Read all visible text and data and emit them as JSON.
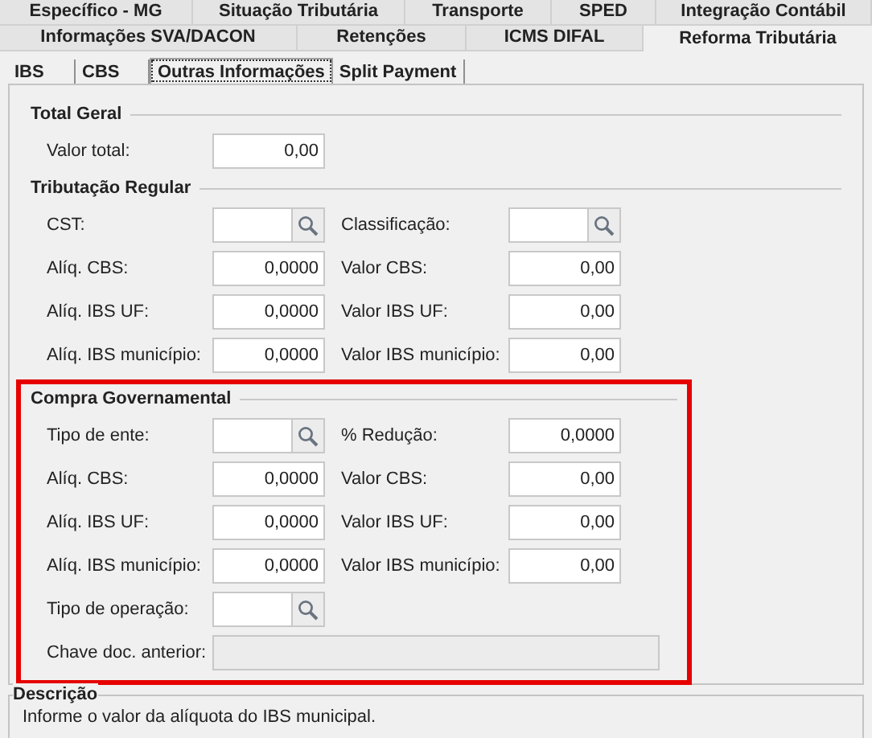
{
  "tab_rows": [
    [
      {
        "label": "Específico - MG",
        "selected": false
      },
      {
        "label": "Situação Tributária",
        "selected": false
      },
      {
        "label": "Transporte",
        "selected": false
      },
      {
        "label": "SPED",
        "selected": false
      },
      {
        "label": "Integração Contábil",
        "selected": false
      }
    ],
    [
      {
        "label": "Informações SVA/DACON",
        "selected": false
      },
      {
        "label": "Retenções",
        "selected": false
      },
      {
        "label": "ICMS DIFAL",
        "selected": false
      },
      {
        "label": "Reforma Tributária",
        "selected": true
      }
    ]
  ],
  "sub_tabs": [
    {
      "label": "IBS",
      "selected": false
    },
    {
      "label": "CBS",
      "selected": false
    },
    {
      "label": "Outras Informações",
      "selected": true
    },
    {
      "label": "Split Payment",
      "selected": false
    }
  ],
  "sections": [
    {
      "title": "Total Geral",
      "highlighted": false,
      "rows": [
        [
          {
            "label": "Valor total:",
            "kind": "number",
            "value": "0,00"
          }
        ]
      ]
    },
    {
      "title": "Tributação Regular",
      "highlighted": false,
      "rows": [
        [
          {
            "label": "CST:",
            "kind": "lookup"
          },
          {
            "label": "Classificação:",
            "kind": "lookup"
          }
        ],
        [
          {
            "label": "Alíq. CBS:",
            "kind": "number",
            "value": "0,0000"
          },
          {
            "label": "Valor CBS:",
            "kind": "number",
            "value": "0,00"
          }
        ],
        [
          {
            "label": "Alíq. IBS UF:",
            "kind": "number",
            "value": "0,0000"
          },
          {
            "label": "Valor IBS UF:",
            "kind": "number",
            "value": "0,00"
          }
        ],
        [
          {
            "label": "Alíq. IBS município:",
            "kind": "number",
            "value": "0,0000"
          },
          {
            "label": "Valor IBS município:",
            "kind": "number",
            "value": "0,00"
          }
        ]
      ]
    },
    {
      "title": "Compra Governamental",
      "highlighted": true,
      "rows": [
        [
          {
            "label": "Tipo de ente:",
            "kind": "lookup"
          },
          {
            "label": "% Redução:",
            "kind": "number",
            "value": "0,0000"
          }
        ],
        [
          {
            "label": "Alíq. CBS:",
            "kind": "number",
            "value": "0,0000"
          },
          {
            "label": "Valor CBS:",
            "kind": "number",
            "value": "0,00"
          }
        ],
        [
          {
            "label": "Alíq. IBS UF:",
            "kind": "number",
            "value": "0,0000"
          },
          {
            "label": "Valor IBS UF:",
            "kind": "number",
            "value": "0,00"
          }
        ],
        [
          {
            "label": "Alíq. IBS município:",
            "kind": "number",
            "value": "0,0000"
          },
          {
            "label": "Valor IBS município:",
            "kind": "number",
            "value": "0,00"
          }
        ],
        [
          {
            "label": "Tipo de operação:",
            "kind": "lookup"
          }
        ],
        [
          {
            "label": "Chave doc. anterior:",
            "kind": "readonly"
          }
        ]
      ]
    }
  ],
  "description": {
    "title": "Descrição",
    "text": "Informe o valor da alíquota do IBS municipal."
  }
}
